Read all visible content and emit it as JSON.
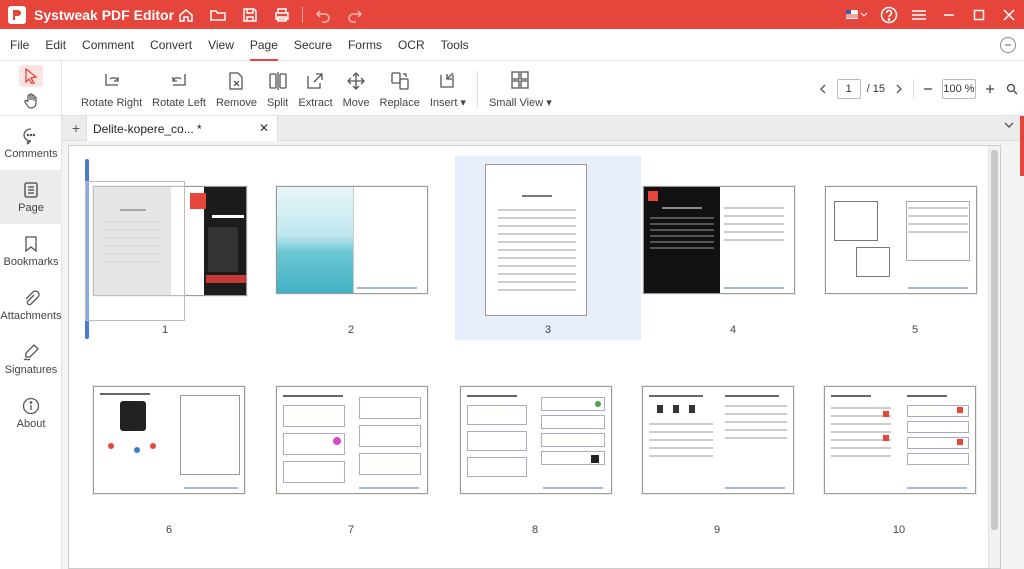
{
  "app": {
    "title": "Systweak PDF Editor",
    "brand_color": "#e5453b"
  },
  "titlebar_icons": [
    "home-icon",
    "folder-icon",
    "save-icon",
    "print-icon",
    "undo-icon",
    "redo-icon"
  ],
  "window_icons": [
    "flag-icon",
    "help-icon",
    "hamburger-icon",
    "minimize-icon",
    "maximize-icon",
    "close-icon"
  ],
  "menu": [
    "File",
    "Edit",
    "Comment",
    "Convert",
    "View",
    "Page",
    "Secure",
    "Forms",
    "OCR",
    "Tools"
  ],
  "menu_active": "Page",
  "toolbar": {
    "rotate_right": "Rotate Right",
    "rotate_left": "Rotate Left",
    "remove": "Remove",
    "split": "Split",
    "extract": "Extract",
    "move": "Move",
    "replace": "Replace",
    "insert": "Insert",
    "small_view": "Small View"
  },
  "pager": {
    "current": "1",
    "total": "/ 15",
    "zoom": "100 %"
  },
  "sidebar": {
    "comments": "Comments",
    "page": "Page",
    "bookmarks": "Bookmarks",
    "attachments": "Attachments",
    "signatures": "Signatures",
    "about": "About"
  },
  "tab": {
    "title": "Delite-kopere_co... *",
    "add": "+",
    "close": "✕"
  },
  "pages": {
    "p1": "1",
    "p2": "2",
    "p3": "3",
    "p4": "4",
    "p5": "5",
    "p6": "6",
    "p7": "7",
    "p8": "8",
    "p9": "9",
    "p10": "10"
  },
  "selected_page": "3"
}
